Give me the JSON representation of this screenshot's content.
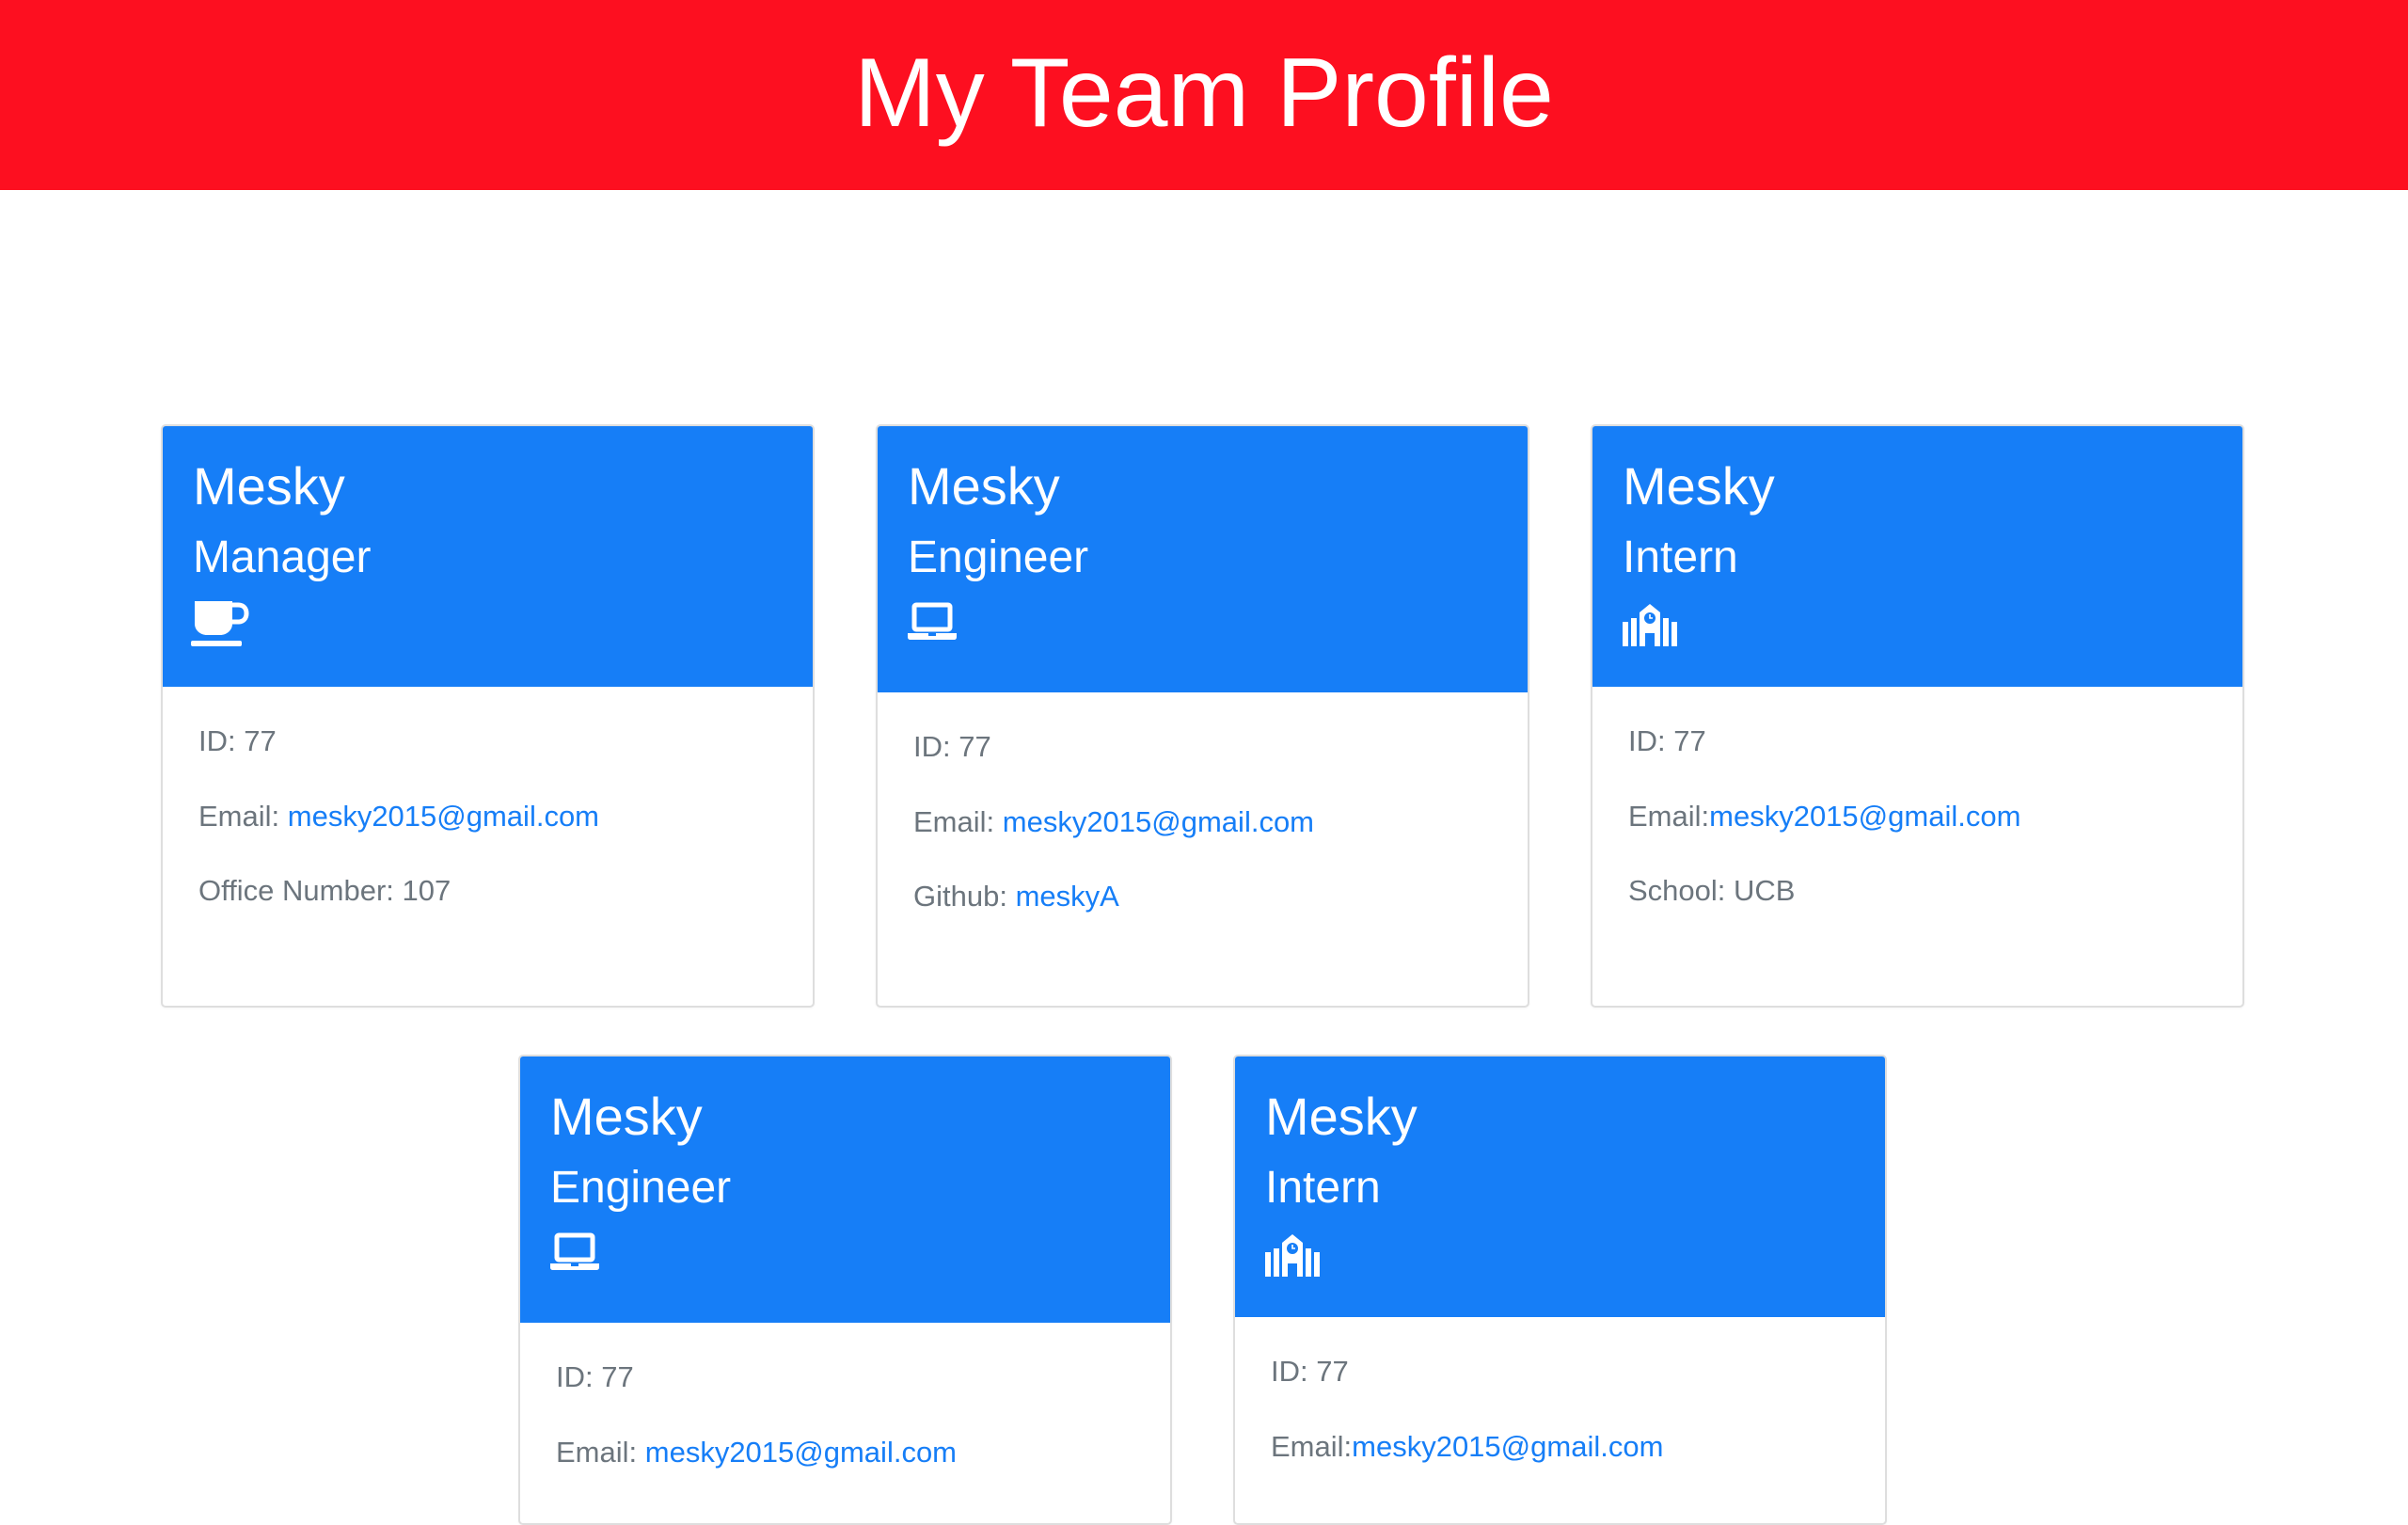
{
  "header": {
    "title": "My Team Profile"
  },
  "colors": {
    "header_bg": "#fd0f20",
    "card_head_bg": "#167ef7",
    "link": "#167ef7",
    "muted_text": "#6c757d"
  },
  "cards": [
    {
      "name": "Mesky",
      "role": "Manager",
      "icon": "coffee-mug-icon",
      "id_label": "ID: 77",
      "email_label": "Email: ",
      "email": "mesky2015@gmail.com",
      "extra_label": "Office Number: 107"
    },
    {
      "name": "Mesky",
      "role": "Engineer",
      "icon": "laptop-icon",
      "id_label": "ID: 77",
      "email_label": "Email: ",
      "email": "mesky2015@gmail.com",
      "extra_label": "Github: ",
      "extra_link": "meskyA"
    },
    {
      "name": "Mesky",
      "role": "Intern",
      "icon": "school-icon",
      "id_label": "ID: 77",
      "email_label": "Email:",
      "email": "mesky2015@gmail.com",
      "extra_label": "School: UCB"
    },
    {
      "name": "Mesky",
      "role": "Engineer",
      "icon": "laptop-icon",
      "id_label": "ID: 77",
      "email_label": "Email: ",
      "email": "mesky2015@gmail.com"
    },
    {
      "name": "Mesky",
      "role": "Intern",
      "icon": "school-icon",
      "id_label": "ID: 77",
      "email_label": "Email:",
      "email": "mesky2015@gmail.com"
    }
  ]
}
